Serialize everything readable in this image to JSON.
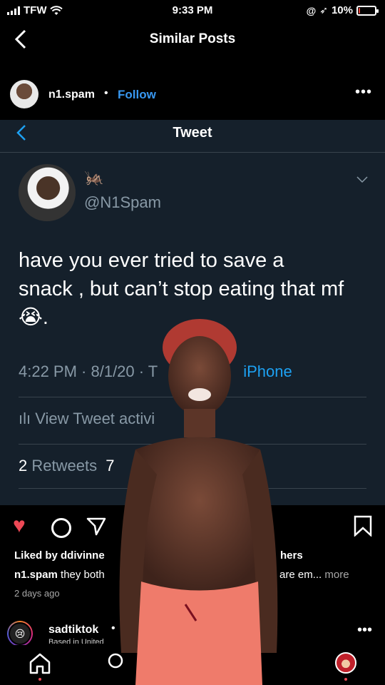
{
  "status_bar": {
    "carrier": "TFW",
    "time": "9:33 PM",
    "battery": "10%",
    "battery_level": 0.1
  },
  "header": {
    "title": "Similar Posts"
  },
  "post": {
    "username": "n1.spam",
    "separator": "•",
    "follow_label": "Follow",
    "more_label": "•••",
    "tweet": {
      "header_title": "Tweet",
      "emoji": "🦗",
      "handle": "@N1Spam",
      "text_line1": "have you ever tried to save a",
      "text_line2": "snack , but can’t stop eating that mf",
      "text_line3": "😭.",
      "meta_time": "4:22 PM · 8/1/20 · T",
      "meta_via": "iPhone",
      "activity": "ılı View Tweet activi",
      "retweets_count": "2",
      "retweets_label": "Retweets",
      "likes_count": "7"
    },
    "liked_by_prefix": "Liked by ddivinne",
    "liked_by_suffix": "hers",
    "caption_user": "n1.spam",
    "caption_text": "they both",
    "caption_tail": "are em...",
    "caption_more": "more",
    "date": "2 days ago"
  },
  "next_post": {
    "username": "sadtiktok",
    "separator": "•",
    "subtitle": "Based in United",
    "more_label": "•••"
  },
  "colors": {
    "accent": "#3897f0",
    "tweet_bg": "#15202b",
    "tweet_muted": "#8899a6",
    "twitter_blue": "#1da1f2",
    "like_red": "#ed4956"
  }
}
